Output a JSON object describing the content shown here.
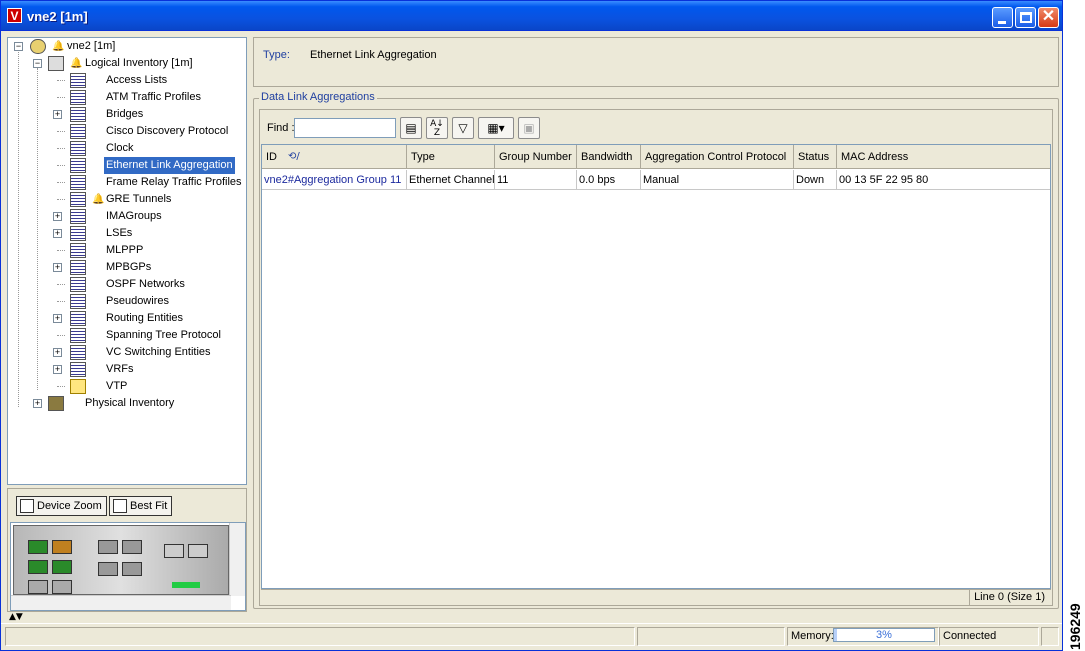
{
  "window": {
    "title": "vne2 [1m]",
    "app_icon_letter": "V"
  },
  "tree": {
    "root": {
      "label": "vne2 [1m]"
    },
    "logical": {
      "label": "Logical Inventory [1m]"
    },
    "items": [
      {
        "label": "Access Lists",
        "expandable": false
      },
      {
        "label": "ATM Traffic Profiles",
        "expandable": false
      },
      {
        "label": "Bridges",
        "expandable": true
      },
      {
        "label": "Cisco Discovery Protocol",
        "expandable": false
      },
      {
        "label": "Clock",
        "expandable": false
      },
      {
        "label": "Ethernet Link Aggregation",
        "expandable": false,
        "selected": true
      },
      {
        "label": "Frame Relay Traffic Profiles",
        "expandable": false
      },
      {
        "label": "GRE Tunnels",
        "expandable": false,
        "alarm": true
      },
      {
        "label": "IMAGroups",
        "expandable": true
      },
      {
        "label": "LSEs",
        "expandable": true
      },
      {
        "label": "MLPPP",
        "expandable": false
      },
      {
        "label": "MPBGPs",
        "expandable": true
      },
      {
        "label": "OSPF Networks",
        "expandable": false
      },
      {
        "label": "Pseudowires",
        "expandable": false
      },
      {
        "label": "Routing Entities",
        "expandable": true
      },
      {
        "label": "Spanning Tree Protocol",
        "expandable": false
      },
      {
        "label": "VC Switching Entities",
        "expandable": true
      },
      {
        "label": "VRFs",
        "expandable": true
      },
      {
        "label": "VTP",
        "expandable": false,
        "icon": "envelope-icon"
      }
    ],
    "physical": {
      "label": "Physical Inventory"
    }
  },
  "zoom": {
    "device_zoom": "Device Zoom",
    "best_fit": "Best Fit"
  },
  "type_section": {
    "key": "Type:",
    "value": "Ethernet Link Aggregation"
  },
  "dla": {
    "title": "Data Link Aggregations",
    "find_label": "Find :",
    "find_value": "",
    "columns": [
      "ID",
      "Type",
      "Group Number",
      "Bandwidth",
      "Aggregation Control Protocol",
      "Status",
      "MAC Address"
    ],
    "rows": [
      [
        "vne2#Aggregation Group 11",
        "Ethernet Channel",
        "11",
        "0.0 bps",
        "Manual",
        "Down",
        "00 13 5F 22 95 80"
      ]
    ],
    "line_status": "Line 0 (Size 1)"
  },
  "statusbar": {
    "memory_label": "Memory:",
    "memory_value": "3%",
    "memory_fraction": 0.03,
    "connection": "Connected"
  },
  "figure_id": "196249",
  "colors": {
    "titlebar": "#0a52e0",
    "selection": "#316ac5",
    "link": "#1c2a9e",
    "chrome": "#ece9d8"
  }
}
